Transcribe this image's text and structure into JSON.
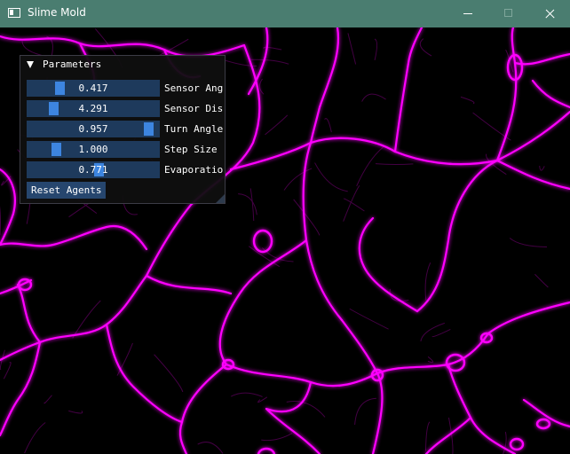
{
  "window": {
    "title": "Slime Mold",
    "icon": "app-window-icon",
    "controls": [
      "minimize-icon",
      "maximize-icon",
      "close-icon"
    ]
  },
  "panel": {
    "title": "Parameters",
    "sliders": [
      {
        "value": "0.417",
        "label": "Sensor Ang",
        "fraction": 0.22
      },
      {
        "value": "4.291",
        "label": "Sensor Dis",
        "fraction": 0.17
      },
      {
        "value": "0.957",
        "label": "Turn Angle",
        "fraction": 0.96
      },
      {
        "value": "1.000",
        "label": "Step Size",
        "fraction": 0.19
      },
      {
        "value": "0.771",
        "label": "Evaporatio",
        "fraction": 0.55
      }
    ],
    "reset_label": "Reset Agents"
  },
  "colors": {
    "titlebar": "#4a7d70",
    "trail": "#ff00ff",
    "slider_track": "#1e3a5c",
    "slider_grab": "#3d85e0",
    "button": "#26466e"
  }
}
